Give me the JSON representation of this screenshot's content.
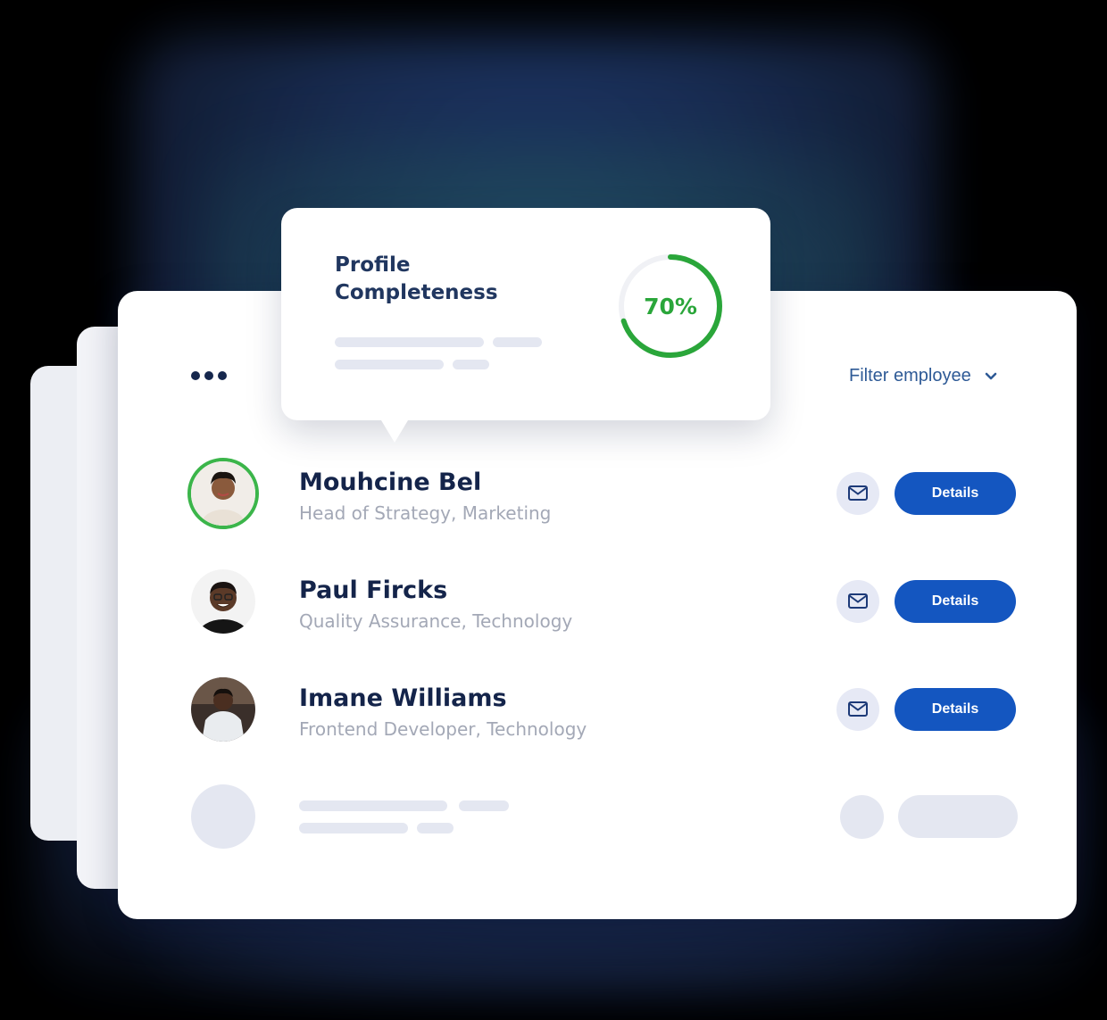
{
  "header": {
    "filter_label": "Filter employee"
  },
  "profile_card": {
    "title": "Profile Completeness",
    "completeness_percent": 70,
    "completeness_label": "70%",
    "ring_color": "#2aa63a"
  },
  "employees": [
    {
      "name": "Mouhcine Bel",
      "role": "Head of Strategy, Marketing",
      "details_label": "Details",
      "selected": true
    },
    {
      "name": "Paul Fircks",
      "role": "Quality Assurance, Technology",
      "details_label": "Details",
      "selected": false
    },
    {
      "name": "Imane Williams",
      "role": "Frontend Developer, Technology",
      "details_label": "Details",
      "selected": false
    }
  ],
  "colors": {
    "primary_button": "#1456c0",
    "selected_ring": "#3bb54a",
    "name_text": "#14244a",
    "role_text": "#a3a8b6",
    "filter_text": "#2e5a96"
  },
  "icons": {
    "more": "more-horizontal-icon",
    "filter_chevron": "chevron-down-icon",
    "mail": "mail-icon"
  }
}
